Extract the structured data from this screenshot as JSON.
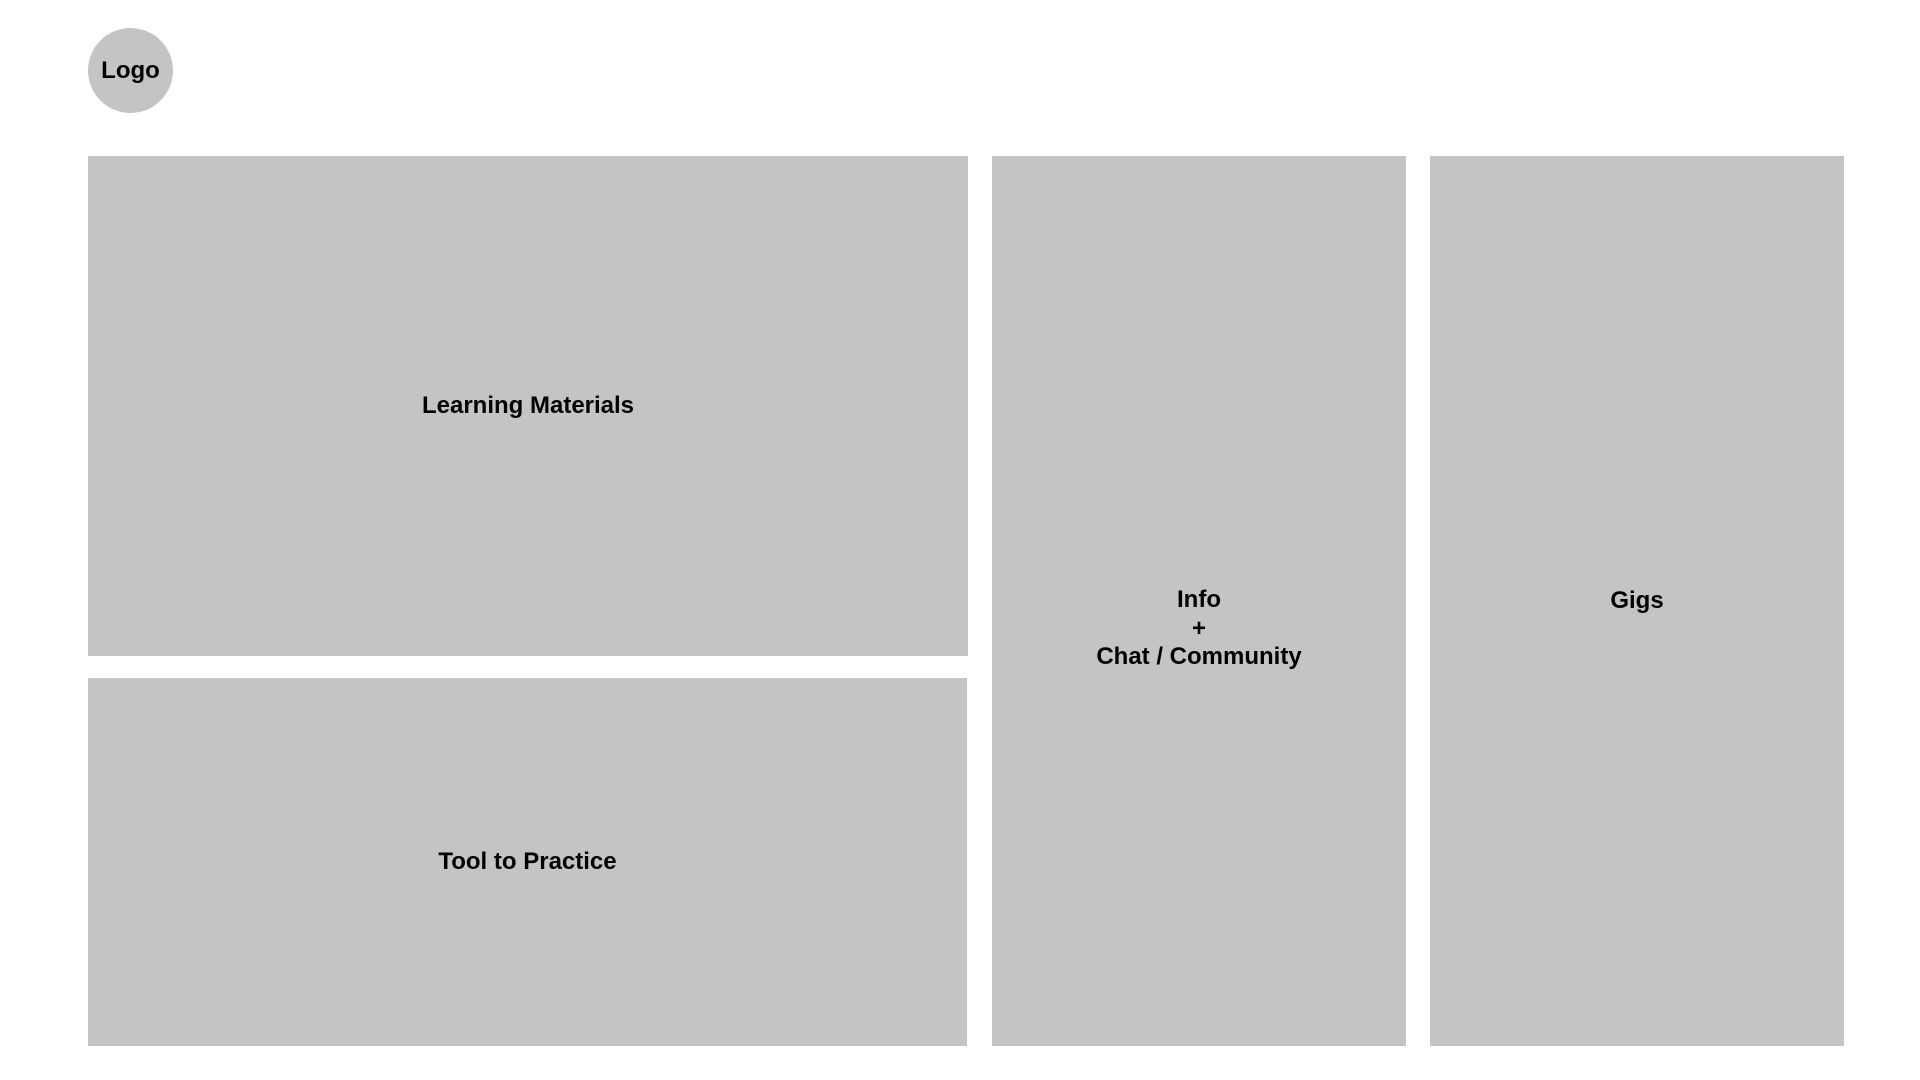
{
  "logo": {
    "label": "Logo"
  },
  "panels": {
    "learning_materials": {
      "label": "Learning Materials"
    },
    "tool_to_practice": {
      "label": "Tool to Practice"
    },
    "info_chat_community": {
      "line1": "Info",
      "line2": "+",
      "line3": "Chat / Community"
    },
    "gigs": {
      "label": "Gigs"
    }
  },
  "colors": {
    "panel_fill": "#c4c4c4",
    "background": "#ffffff",
    "text": "#000000"
  }
}
